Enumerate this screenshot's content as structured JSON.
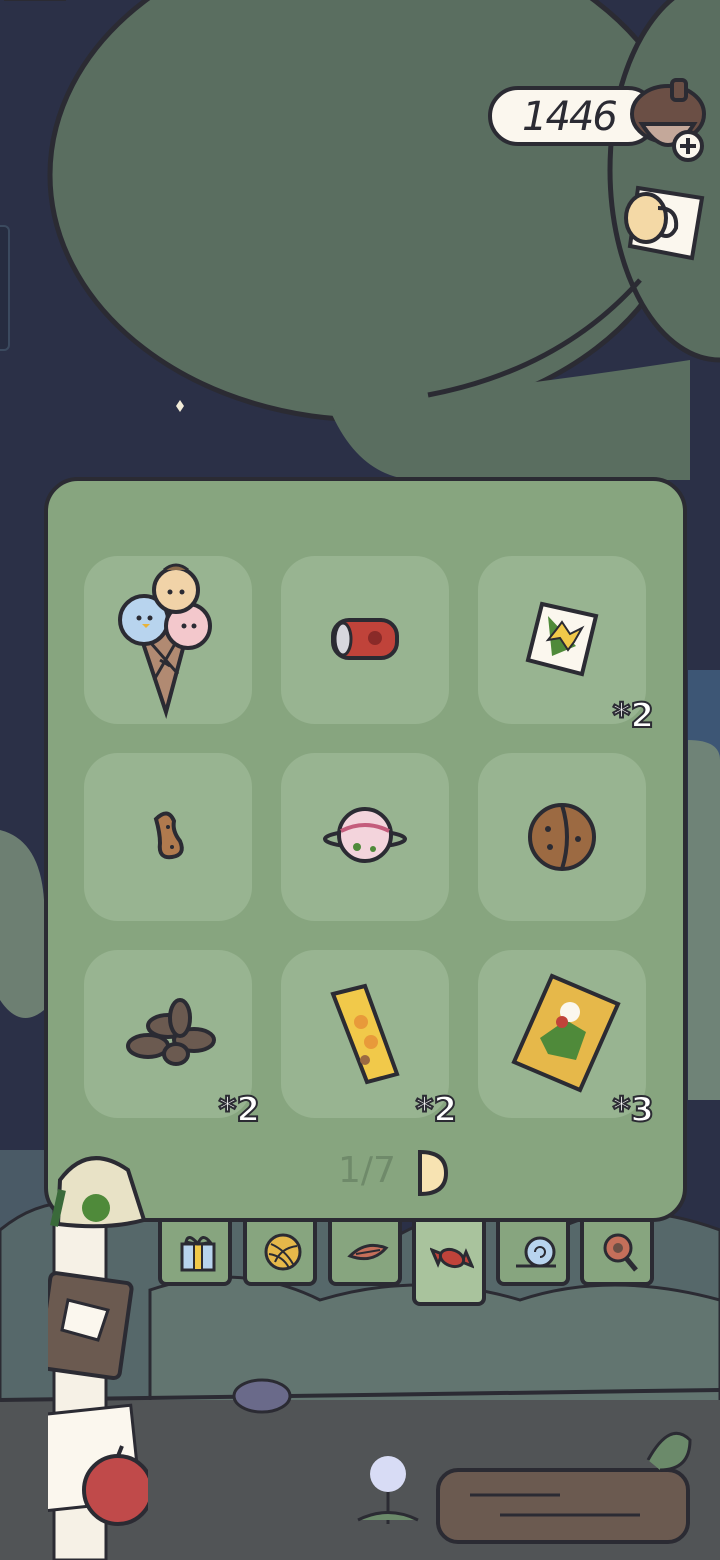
{
  "currency": {
    "amount": "1446",
    "icon": "acorn-icon"
  },
  "inventory": {
    "page": "1/7",
    "items": [
      {
        "name": "ice-cream-cone",
        "count": ""
      },
      {
        "name": "soda-can",
        "count": ""
      },
      {
        "name": "candy-wrapper",
        "count": "*2"
      },
      {
        "name": "peanut",
        "count": ""
      },
      {
        "name": "planet-candy",
        "count": ""
      },
      {
        "name": "walnut",
        "count": ""
      },
      {
        "name": "sunflower-seeds",
        "count": "*2"
      },
      {
        "name": "biscuit-stick",
        "count": "*2"
      },
      {
        "name": "snack-bag",
        "count": "*3"
      }
    ]
  },
  "tabs": [
    {
      "name": "gift",
      "active": false
    },
    {
      "name": "yarn",
      "active": false
    },
    {
      "name": "leaf",
      "active": false
    },
    {
      "name": "candy",
      "active": true
    },
    {
      "name": "snail",
      "active": false
    },
    {
      "name": "magnifier",
      "active": false
    }
  ],
  "colors": {
    "panel": "#87a57f",
    "slot": "#98b491",
    "outline": "#2b2b33",
    "sky": "#2b3047"
  }
}
